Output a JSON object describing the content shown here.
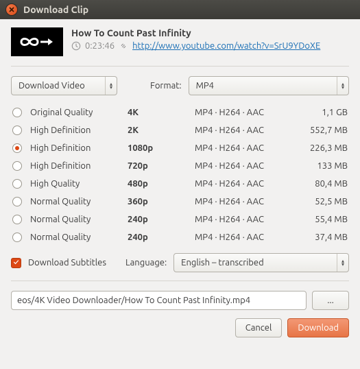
{
  "window": {
    "title": "Download Clip"
  },
  "video": {
    "title": "How To Count Past Infinity",
    "duration": "0:23:46",
    "url": "http://www.youtube.com/watch?v=SrU9YDoXE"
  },
  "controls": {
    "download_mode": "Download Video",
    "format_label": "Format:",
    "format_value": "MP4"
  },
  "qualities": [
    {
      "name": "Original Quality",
      "res": "4K",
      "codec": "MP4 · H264 · AAC",
      "size": "1,1 GB",
      "selected": false
    },
    {
      "name": "High Definition",
      "res": "2K",
      "codec": "MP4 · H264 · AAC",
      "size": "552,7 MB",
      "selected": false
    },
    {
      "name": "High Definition",
      "res": "1080p",
      "codec": "MP4 · H264 · AAC",
      "size": "226,3 MB",
      "selected": true
    },
    {
      "name": "High Definition",
      "res": "720p",
      "codec": "MP4 · H264 · AAC",
      "size": "133 MB",
      "selected": false
    },
    {
      "name": "High Quality",
      "res": "480p",
      "codec": "MP4 · H264 · AAC",
      "size": "80,4 MB",
      "selected": false
    },
    {
      "name": "Normal Quality",
      "res": "360p",
      "codec": "MP4 · H264 · AAC",
      "size": "52,5 MB",
      "selected": false
    },
    {
      "name": "Normal Quality",
      "res": "240p",
      "codec": "MP4 · H264 · AAC",
      "size": "55,4 MB",
      "selected": false
    },
    {
      "name": "Normal Quality",
      "res": "240p",
      "codec": "MP4 · H264 · AAC",
      "size": "37,4 MB",
      "selected": false
    }
  ],
  "subtitles": {
    "checked": true,
    "label": "Download Subtitles",
    "language_label": "Language:",
    "language_value": "English – transcribed"
  },
  "path": {
    "value": "eos/4K Video Downloader/How To Count Past Infinity.mp4",
    "browse": "..."
  },
  "footer": {
    "cancel": "Cancel",
    "download": "Download"
  }
}
